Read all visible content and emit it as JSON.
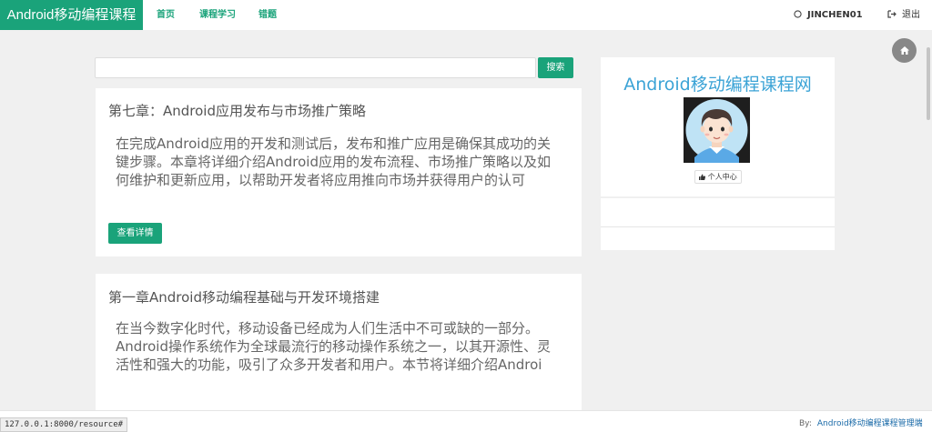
{
  "brand": "Android移动编程课程",
  "nav": [
    {
      "label": "首页"
    },
    {
      "label": "课程学习"
    },
    {
      "label": "错题"
    }
  ],
  "user": {
    "name": "JINCHEN01",
    "logout": "退出"
  },
  "search": {
    "button": "搜索",
    "placeholder": ""
  },
  "cards": [
    {
      "title": "第七章：Android应用发布与市场推广策略",
      "desc": "在完成Android应用的开发和测试后，发布和推广应用是确保其成功的关键步骤。本章将详细介绍Android应用的发布流程、市场推广策略以及如何维护和更新应用，以帮助开发者将应用推向市场并获得用户的认可",
      "button": "查看详情"
    },
    {
      "title": "第一章Android移动编程基础与开发环境搭建",
      "desc": "在当今数字化时代，移动设备已经成为人们生活中不可或缺的一部分。Android操作系统作为全球最流行的移动操作系统之一，以其开源性、灵活性和强大的功能，吸引了众多开发者和用户。本节将详细介绍Androi"
    }
  ],
  "profile": {
    "title": "Android移动编程课程网",
    "button": "个人中心"
  },
  "footer": {
    "by": "By:",
    "link": "Android移动编程课程管理端"
  },
  "status_url": "127.0.0.1:8000/resource#",
  "colors": {
    "accent": "#1aa37a",
    "title_blue": "#3ba3d6"
  },
  "icons": [
    "user-icon",
    "logout-icon",
    "home-icon",
    "thumbs-up-icon"
  ]
}
